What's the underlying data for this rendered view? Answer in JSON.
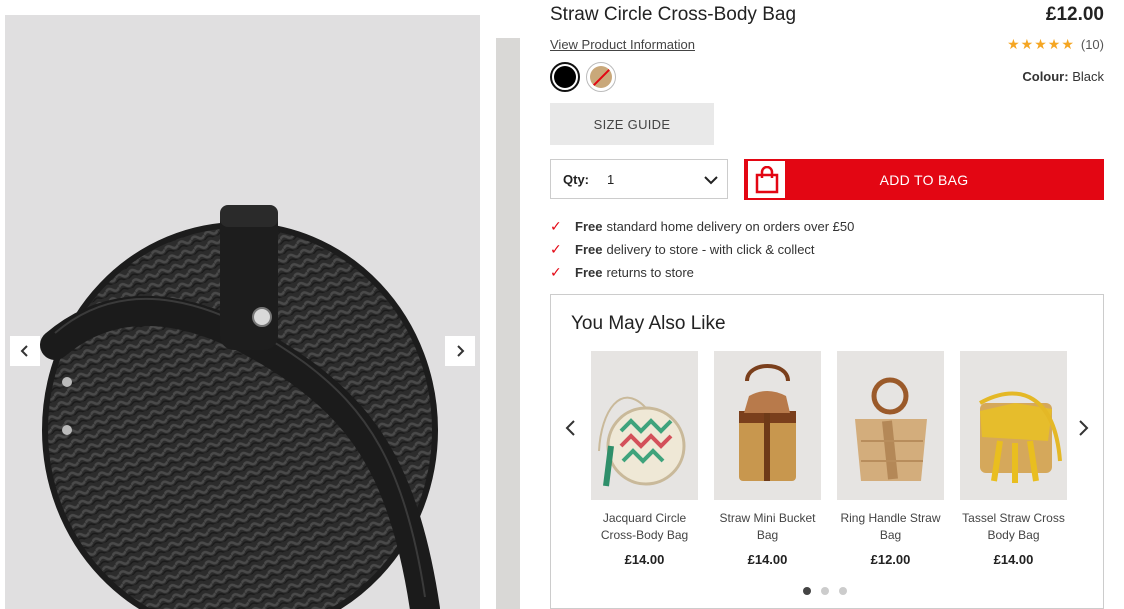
{
  "product": {
    "title": "Straw Circle Cross-Body Bag",
    "price": "£12.00",
    "view_info_label": "View Product Information",
    "rating_stars": "★★★★★",
    "rating_count": "(10)",
    "colour_label": "Colour:",
    "colour_value": "Black",
    "swatches": [
      "Black",
      "Natural"
    ],
    "size_guide_label": "SIZE GUIDE",
    "qty_label": "Qty:",
    "qty_value": "1",
    "add_to_bag_label": "ADD TO BAG"
  },
  "benefits": [
    {
      "bold": "Free",
      "text": "standard home delivery on orders over £50"
    },
    {
      "bold": "Free",
      "text": "delivery to store - with click & collect"
    },
    {
      "bold": "Free",
      "text": "returns to store"
    }
  ],
  "ymal": {
    "title": "You May Also Like",
    "items": [
      {
        "name": "Jacquard Circle Cross-Body Bag",
        "price": "£14.00"
      },
      {
        "name": "Straw Mini Bucket Bag",
        "price": "£14.00"
      },
      {
        "name": "Ring Handle Straw Bag",
        "price": "£12.00"
      },
      {
        "name": "Tassel Straw Cross Body Bag",
        "price": "£14.00"
      }
    ],
    "page_count": 3,
    "active_page": 1
  },
  "colors": {
    "accent": "#e30613",
    "star": "#f5a623"
  }
}
